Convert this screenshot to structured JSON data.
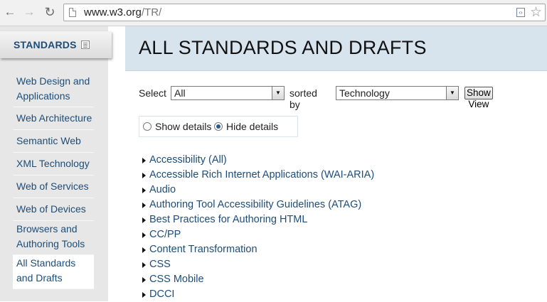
{
  "browser": {
    "url_host": "www.w3.org",
    "url_path": "/TR/",
    "back_glyph": "←",
    "forward_glyph": "→",
    "reload_glyph": "↻",
    "star_glyph": "☆"
  },
  "sidebar": {
    "title": "STANDARDS",
    "items": [
      {
        "label": "Web Design and Applications"
      },
      {
        "label": "Web Architecture"
      },
      {
        "label": "Semantic Web"
      },
      {
        "label": "XML Technology"
      },
      {
        "label": "Web of Services"
      },
      {
        "label": "Web of Devices"
      },
      {
        "label": "Browsers and Authoring Tools"
      },
      {
        "label": "All Standards and Drafts",
        "active": true
      }
    ]
  },
  "main": {
    "title": "ALL STANDARDS AND DRAFTS",
    "filter": {
      "select_label": "Select",
      "select_value": "All",
      "sorted_label": "sorted by",
      "sort_value": "Technology",
      "button_label": "Show View"
    },
    "details": {
      "show_label": "Show details",
      "hide_label": "Hide details",
      "selected": "hide"
    },
    "technologies": [
      "Accessibility (All)",
      "Accessible Rich Internet Applications (WAI-ARIA)",
      "Audio",
      "Authoring Tool Accessibility Guidelines (ATAG)",
      "Best Practices for Authoring HTML",
      "CC/PP",
      "Content Transformation",
      "CSS",
      "CSS Mobile",
      "DCCI"
    ]
  },
  "colors": {
    "link": "#1d4d78",
    "banner": "#d7e4ee",
    "sidebar_bg": "#e7e7e7"
  }
}
